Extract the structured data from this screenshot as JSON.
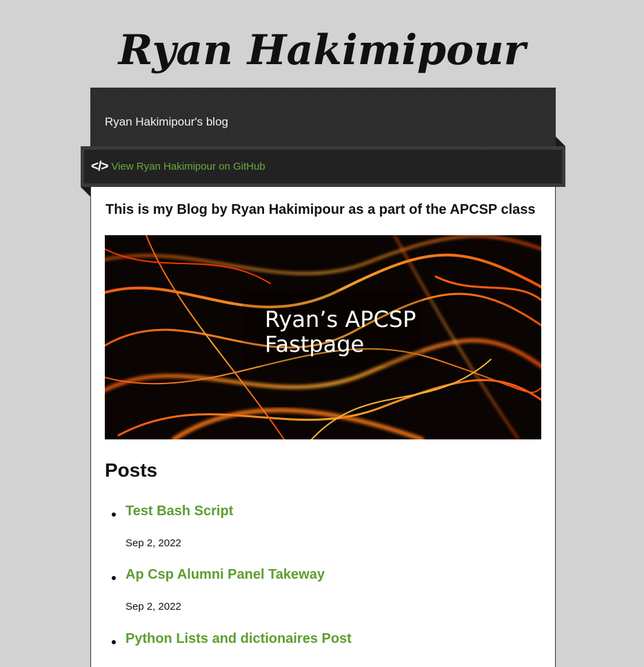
{
  "site": {
    "title": "Ryan Hakimipour"
  },
  "header": {
    "tagline": "Ryan Hakimipour's blog"
  },
  "ribbon": {
    "icon": "code-icon",
    "icon_glyph": "</>",
    "link_label": "View Ryan Hakimipour on GitHub",
    "link_color": "#6aad3d"
  },
  "intro": "This is my Blog by Ryan Hakimipour as a part of the APCSP class",
  "banner": {
    "line1": "Ryan’s APCSP",
    "line2": "Fastpage"
  },
  "posts": {
    "heading": "Posts",
    "items": [
      {
        "title": "Test Bash Script",
        "date": "Sep 2, 2022"
      },
      {
        "title": "Ap Csp Alumni Panel Takeway",
        "date": "Sep 2, 2022"
      },
      {
        "title": "Python Lists and dictionaires Post",
        "date": ""
      }
    ]
  },
  "colors": {
    "background": "#d2d2d2",
    "header": "#2a2a2a",
    "accent": "#5d9e30"
  }
}
